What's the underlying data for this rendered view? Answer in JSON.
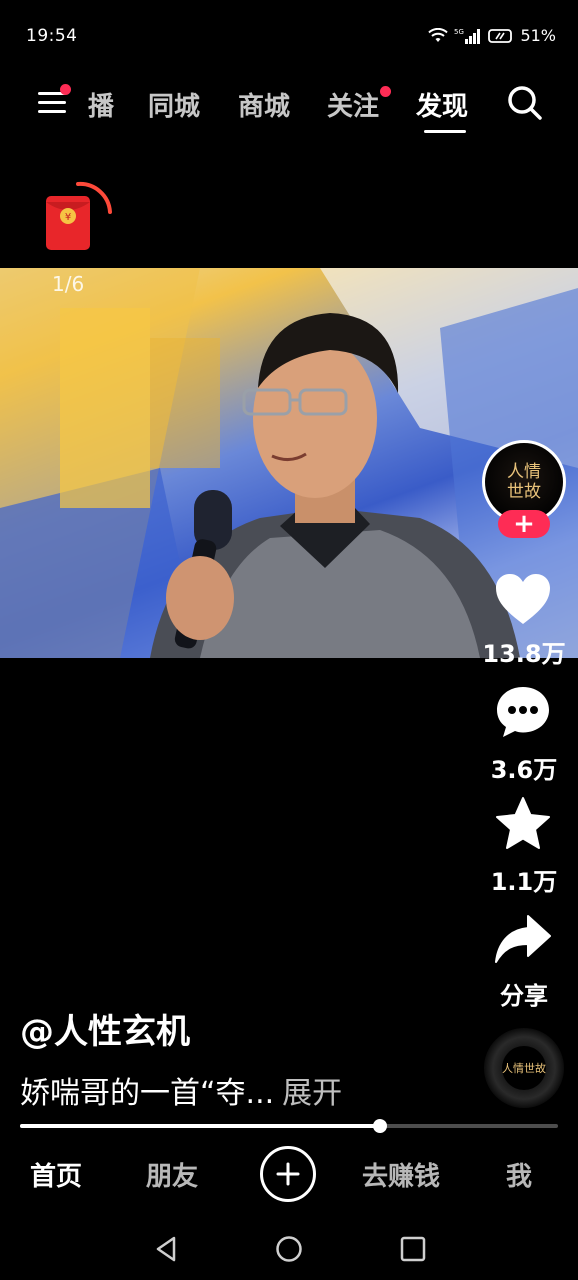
{
  "status_bar": {
    "time": "19:54",
    "network": "5G",
    "battery": "51%",
    "icons": [
      "wifi-icon",
      "signal-icon",
      "battery-icon"
    ]
  },
  "top_nav": {
    "tabs": [
      {
        "label": "播",
        "active": false
      },
      {
        "label": "同城",
        "active": false
      },
      {
        "label": "商城",
        "active": false
      },
      {
        "label": "关注",
        "active": false,
        "dot": true
      },
      {
        "label": "发现",
        "active": true
      }
    ],
    "menu_dot": true
  },
  "video": {
    "counter": "1/6"
  },
  "creator": {
    "avatar_text": "人情世故"
  },
  "actions": {
    "like_count": "13.8万",
    "comment_count": "3.6万",
    "favorite_count": "1.1万",
    "share_label": "分享"
  },
  "post": {
    "author": "@人性玄机",
    "description": "娇喘哥的一首“夺...",
    "expand_label": "展开"
  },
  "music": {
    "disc_text": "人情世故"
  },
  "progress": {
    "fraction": 0.67
  },
  "tab_bar": {
    "home": "首页",
    "friends": "朋友",
    "earn": "去赚钱",
    "me": "我"
  },
  "colors": {
    "accent": "#fe2c55",
    "background": "#000000",
    "gold": "#e8c27a"
  }
}
